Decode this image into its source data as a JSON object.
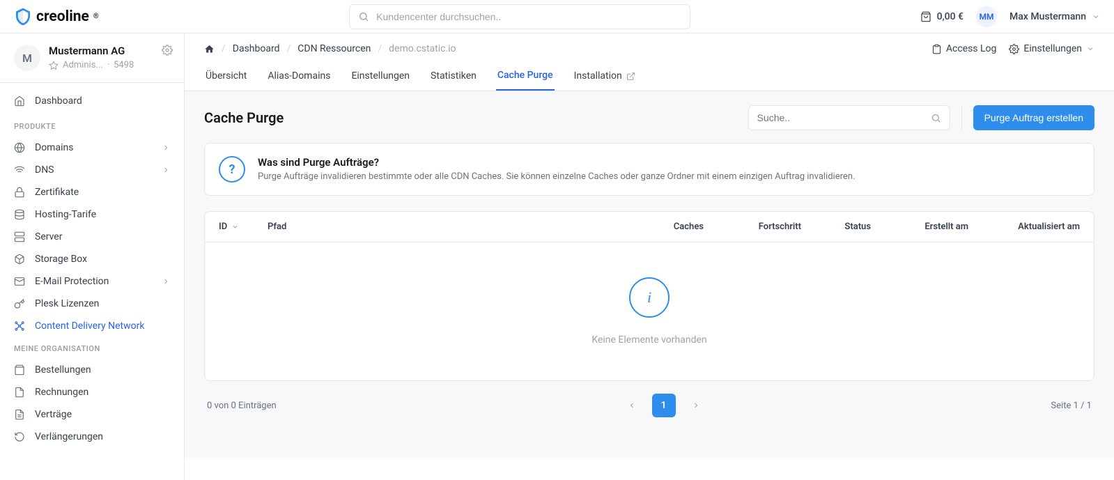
{
  "brand": {
    "name": "creoline"
  },
  "header": {
    "search_placeholder": "Kundencenter durchsuchen..",
    "cart_total": "0,00 €",
    "user_initials": "MM",
    "user_name": "Max Mustermann"
  },
  "org": {
    "initial": "M",
    "name": "Mustermann AG",
    "role": "Adminis...",
    "separator": "·",
    "id": "5498"
  },
  "sidebar": {
    "dashboard": "Dashboard",
    "section_products": "PRODUKTE",
    "items": {
      "domains": "Domains",
      "dns": "DNS",
      "zertifikate": "Zertifikate",
      "hosting": "Hosting-Tarife",
      "server": "Server",
      "storage": "Storage Box",
      "email": "E-Mail Protection",
      "plesk": "Plesk Lizenzen",
      "cdn": "Content Delivery Network"
    },
    "section_org": "MEINE ORGANISATION",
    "org_items": {
      "bestellungen": "Bestellungen",
      "rechnungen": "Rechnungen",
      "vertraege": "Verträge",
      "verlaengerungen": "Verlängerungen"
    }
  },
  "breadcrumb": {
    "dashboard": "Dashboard",
    "resources": "CDN Ressourcen",
    "current": "demo.cstatic.io",
    "access_log": "Access Log",
    "settings": "Einstellungen"
  },
  "tabs": {
    "uebersicht": "Übersicht",
    "alias": "Alias-Domains",
    "einstellungen": "Einstellungen",
    "statistiken": "Statistiken",
    "cache_purge": "Cache Purge",
    "installation": "Installation"
  },
  "page": {
    "title": "Cache Purge",
    "search_placeholder": "Suche..",
    "primary_button": "Purge Auftrag erstellen"
  },
  "callout": {
    "title": "Was sind Purge Aufträge?",
    "body": "Purge Aufträge invalidieren bestimmte oder alle CDN Caches. Sie können einzelne Caches oder ganze Ordner mit einem einzigen Auftrag invalidieren."
  },
  "table": {
    "cols": {
      "id": "ID",
      "pfad": "Pfad",
      "caches": "Caches",
      "fortschritt": "Fortschritt",
      "status": "Status",
      "erstellt": "Erstellt am",
      "aktualisiert": "Aktualisiert am"
    },
    "empty": "Keine Elemente vorhanden"
  },
  "pager": {
    "count": "0 von 0 Einträgen",
    "page": "1",
    "page_info": "Seite 1 / 1"
  }
}
